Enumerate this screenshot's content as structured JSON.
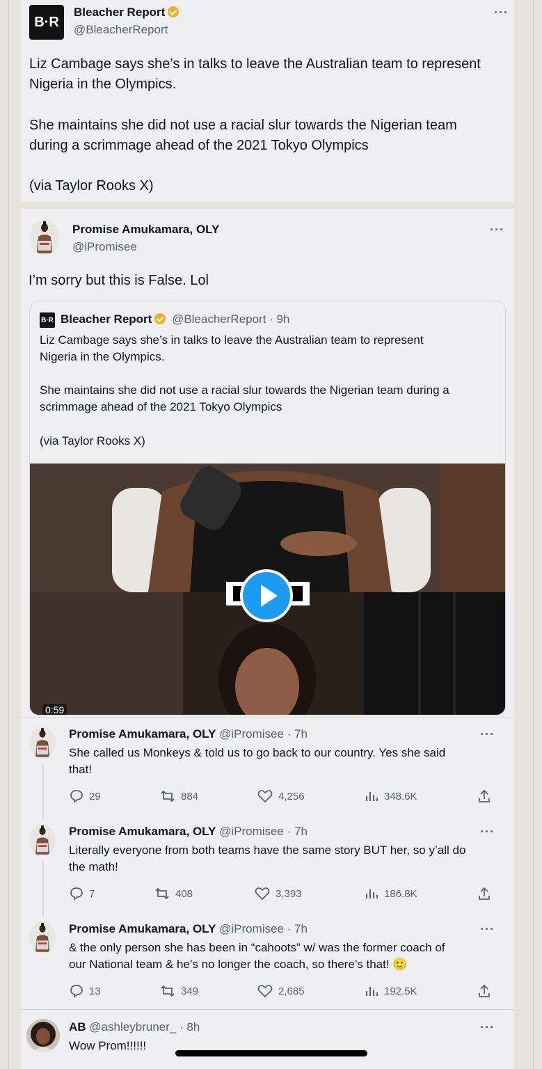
{
  "tweet1": {
    "name": "Bleacher Report",
    "handle": "@BleacherReport",
    "logo_text": "B·R",
    "more": "···",
    "lines": [
      "Liz Cambage says she’s in talks to leave the Australian team to represent",
      "Nigeria in the Olympics.",
      "She maintains she did not use a racial slur towards the Nigerian team",
      "during a scrimmage ahead of the 2021 Tokyo Olympics",
      "(via Taylor Rooks X)"
    ]
  },
  "tweet2": {
    "name": "Promise Amukamara, OLY",
    "handle": "@iPromisee",
    "more": "···",
    "text": "I’m sorry but this is False. Lol",
    "quote": {
      "logo_text": "B·R",
      "name": "Bleacher Report",
      "handle_time": "@BleacherReport · 9h",
      "lines": [
        "Liz Cambage says she’s in talks to leave the Australian team to represent",
        "Nigeria in the Olympics.",
        "She maintains she did not use a racial slur towards the Nigerian team during a",
        "scrimmage ahead of the 2021 Tokyo Olympics",
        "(via Taylor Rooks X)"
      ],
      "video_duration": "0:59"
    }
  },
  "replies": [
    {
      "name": "Promise Amukamara, OLY",
      "handle_time": "@iPromisee · 7h",
      "lines": [
        "She called us Monkeys & told us to go back to our country. Yes she said",
        "that!"
      ],
      "replies": "29",
      "reposts": "884",
      "likes": "4,256",
      "views": "348.6K"
    },
    {
      "name": "Promise Amukamara, OLY",
      "handle_time": "@iPromisee · 7h",
      "lines": [
        "Literally everyone from both teams have the same story BUT her, so y’all do",
        "the math!"
      ],
      "replies": "7",
      "reposts": "408",
      "likes": "3,393",
      "views": "186.8K"
    },
    {
      "name": "Promise Amukamara, OLY",
      "handle_time": "@iPromisee · 7h",
      "lines": [
        "& the only person she has been in “cahoots” w/ was the former coach of",
        "our National team & he’s no longer the coach, so there’s that! 🙂"
      ],
      "replies": "13",
      "reposts": "349",
      "likes": "2,685",
      "views": "192.5K"
    },
    {
      "name": "AB",
      "handle_time": "@ashleybruner_ · 8h",
      "lines": [
        "Wow Prom!!!!!!"
      ]
    }
  ],
  "colors": {
    "verified": "#e8b22a",
    "play": "#1d9bf0",
    "background": "#efeff1"
  },
  "more_label": "···"
}
